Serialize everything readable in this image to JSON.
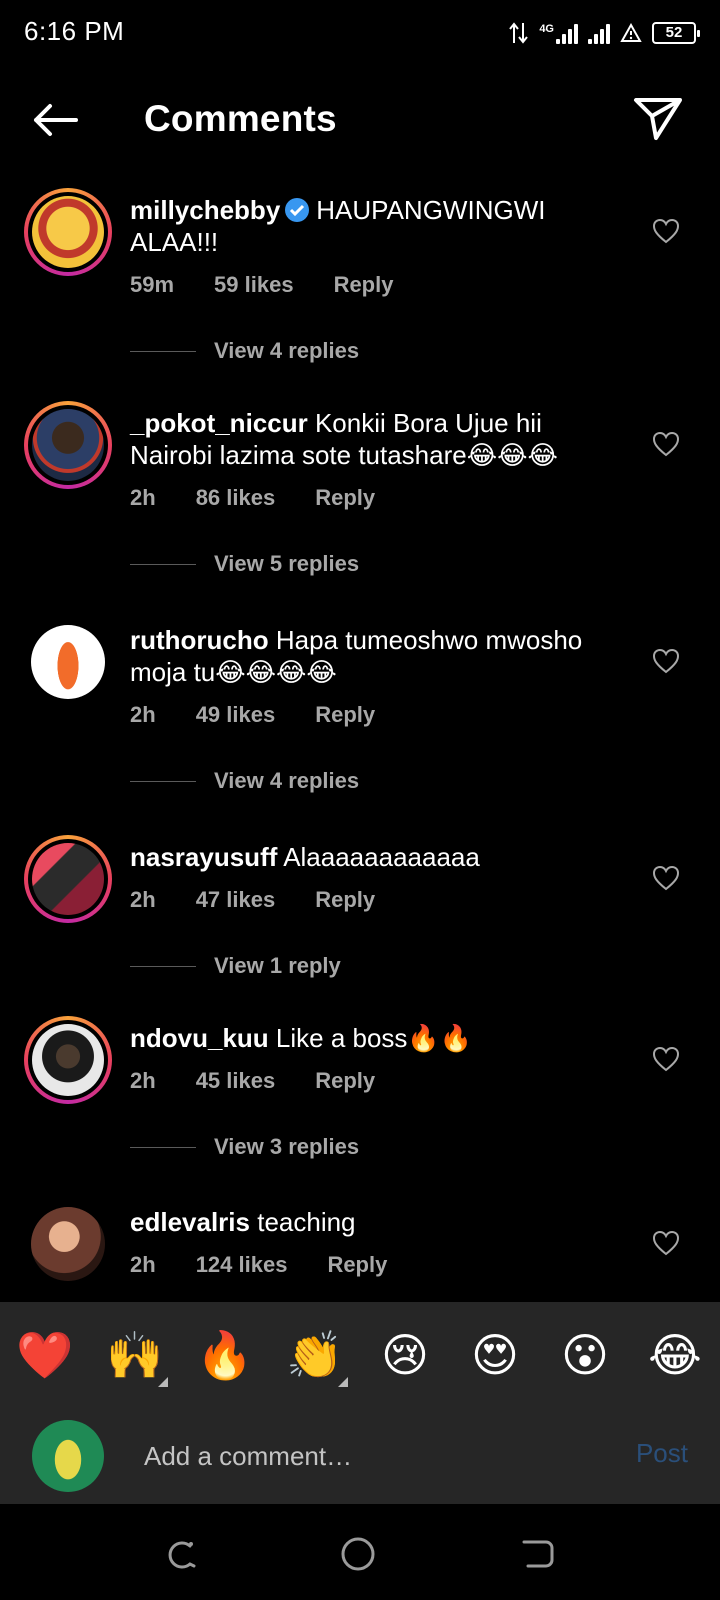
{
  "status_bar": {
    "time": "6:16 PM",
    "network": "4G",
    "battery": "52"
  },
  "header": {
    "title": "Comments",
    "back_icon": "back-arrow-icon",
    "share_icon": "send-icon"
  },
  "comments": [
    {
      "username": "millychebby",
      "verified": true,
      "text": "HAUPANGWINGWI ALAA!!!",
      "time": "59m",
      "likes": "59 likes",
      "reply": "Reply",
      "view_replies": "View 4 replies",
      "avatar_color": "#f3c23a"
    },
    {
      "username": "_pokot_niccur",
      "verified": false,
      "text": "Konkii Bora Ujue hii Nairobi lazima sote tutashare😂😂😂",
      "time": "2h",
      "likes": "86 likes",
      "reply": "Reply",
      "view_replies": "View 5 replies",
      "avatar_color": "#1d2a44"
    },
    {
      "username": "ruthorucho",
      "verified": false,
      "text": "Hapa tumeoshwo mwosho moja tu😂😂😂😂",
      "time": "2h",
      "likes": "49 likes",
      "reply": "Reply",
      "view_replies": "View 4 replies",
      "avatar_color": "#ffffff"
    },
    {
      "username": "nasrayusuff",
      "verified": false,
      "text": "Alaaaaaaaaaaaa",
      "time": "2h",
      "likes": "47 likes",
      "reply": "Reply",
      "view_replies": "View 1 reply",
      "avatar_color": "#8a1f35"
    },
    {
      "username": "ndovu_kuu",
      "verified": false,
      "text": "Like a boss🔥🔥",
      "time": "2h",
      "likes": "45 likes",
      "reply": "Reply",
      "view_replies": "View 3 replies",
      "avatar_color": "#2b2b2b"
    },
    {
      "username": "edlevalris",
      "verified": false,
      "text": "teaching",
      "time": "2h",
      "likes": "124 likes",
      "reply": "Reply",
      "view_replies": "",
      "avatar_color": "#6b3b2e"
    }
  ],
  "emoji_bar": [
    "❤️",
    "🙌",
    "🔥",
    "👏",
    "😢",
    "😍",
    "😮",
    "😂"
  ],
  "composer": {
    "placeholder": "Add a comment…",
    "post_label": "Post"
  },
  "colors": {
    "background": "#000000",
    "panel": "#262626",
    "secondary_text": "#a8a8a8",
    "post_disabled": "#2a4f7a",
    "verified_blue": "#3897f0"
  }
}
